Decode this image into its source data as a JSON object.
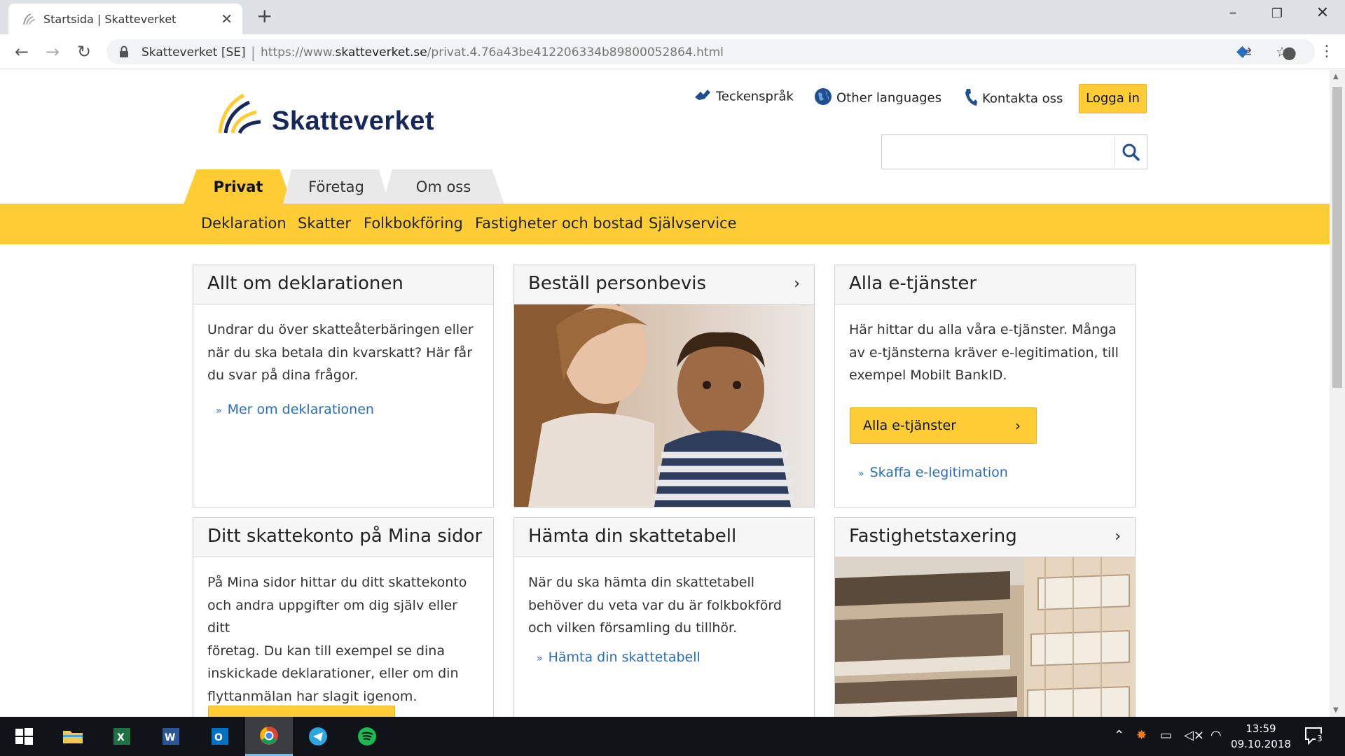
{
  "browser": {
    "tab_title": "Startsida | Skatteverket",
    "site_name": "Skatteverket [SE]",
    "url_prefix": "https://www.",
    "url_domain": "skatteverket.se",
    "url_path": "/privat.4.76a43be412206334b89800052864.html"
  },
  "header": {
    "logo_text": "Skatteverket",
    "util_links": {
      "sign_language": "Teckenspråk",
      "other_languages": "Other languages",
      "contact": "Kontakta oss"
    },
    "login_label": "Logga in",
    "search": {
      "value": ""
    }
  },
  "main_tabs": {
    "privat": "Privat",
    "foretag": "Företag",
    "om_oss": "Om oss"
  },
  "subnav": {
    "deklaration": "Deklaration",
    "skatter": "Skatter",
    "folkbokforing": "Folkbokföring",
    "fastigheter": "Fastigheter och bostad",
    "sjalvservice": "Självservice"
  },
  "cards": {
    "deklaration": {
      "title": "Allt om deklarationen",
      "text_1": "Undrar du över skatteåterbäringen eller",
      "text_2": "när du ska betala din kvarskatt? Här får",
      "text_3": "du svar på dina frågor.",
      "link": "Mer om deklarationen"
    },
    "personbevis": {
      "title": "Beställ personbevis"
    },
    "etjanster": {
      "title": "Alla e-tjänster",
      "text_1": "Här hittar du alla våra e-tjänster. Många",
      "text_2": "av e-tjänsterna kräver e-legitimation, till",
      "text_3": "exempel Mobilt BankID.",
      "button": "Alla e-tjänster",
      "link": "Skaffa e-legitimation"
    },
    "skattekonto": {
      "title": "Ditt skattekonto på Mina sidor",
      "text_1": "På Mina sidor hittar du ditt skattekonto",
      "text_2": "och andra uppgifter om dig själv eller ditt",
      "text_3": "företag. Du kan till exempel se dina",
      "text_4": "inskickade deklarationer, eller om din",
      "text_5": "flyttanmälan har slagit igenom."
    },
    "skattetabell": {
      "title": "Hämta din skattetabell",
      "text_1": "När du ska hämta din skattetabell",
      "text_2": "behöver du veta var du är folkbokförd",
      "text_3": "och vilken församling du tillhör.",
      "link": "Hämta din skattetabell"
    },
    "fastighet": {
      "title": "Fastighetstaxering"
    }
  },
  "taskbar": {
    "time": "13:59",
    "date": "09.10.2018",
    "notifications": "3"
  },
  "colors": {
    "accent_yellow": "#fecc35",
    "brand_navy": "#16285a",
    "link_blue": "#2a6ebb"
  }
}
